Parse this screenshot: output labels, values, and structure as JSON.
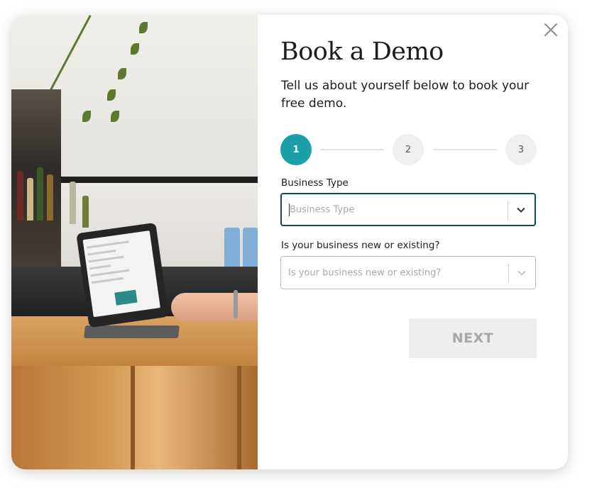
{
  "dialog": {
    "title": "Book a Demo",
    "subtitle": "Tell us about yourself below to book your free demo.",
    "close_icon": "close-icon"
  },
  "stepper": {
    "active_color": "#1ba0a8",
    "steps": [
      {
        "label": "1",
        "state": "active"
      },
      {
        "label": "2",
        "state": "inactive"
      },
      {
        "label": "3",
        "state": "inactive"
      }
    ]
  },
  "form": {
    "business_type": {
      "label": "Business Type",
      "placeholder": "Business Type",
      "value": "",
      "focused": true,
      "icon": "chevron-down-icon"
    },
    "business_status": {
      "label": "Is your business new or existing?",
      "placeholder": "Is your business new or existing?",
      "value": "",
      "icon": "chevron-down-icon"
    }
  },
  "actions": {
    "next_label": "NEXT",
    "next_disabled": true
  },
  "colors": {
    "focus_border": "#124b4e",
    "text": "#1d1d1d"
  }
}
